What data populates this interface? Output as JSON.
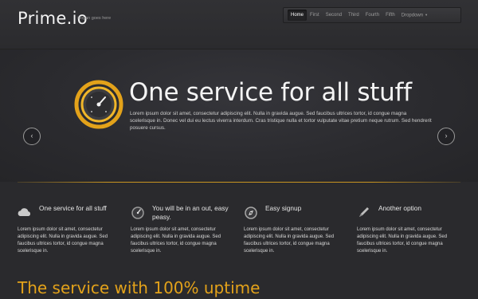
{
  "header": {
    "logo": "Prime.io",
    "slogan": "slogan goes here",
    "nav": [
      "Home",
      "First",
      "Second",
      "Third",
      "Fourth",
      "Fifth",
      "Dropdown"
    ]
  },
  "hero": {
    "title": "One service for all stuff",
    "text": "Lorem ipsum dolor sit amet, consectetur adipiscing elit. Nulla in gravida augue. Sed faucibus ultrices tortor, id congue magna scelerisque in. Donec vel dui eu lectus viverra interdum. Cras tristique nulla et tortor vulputate vitae pretium neque rutrum. Sed hendrerit posuere cursus.",
    "prev_icon": "chevron-left-icon",
    "next_icon": "chevron-right-icon",
    "accent": "#e3a21a"
  },
  "features": [
    {
      "title": "One service for all stuff",
      "icon": "cloud-icon",
      "text": "Lorem ipsum dolor sit amet, consectetur adipiscing elit. Nulla in gravida augue. Sed faucibus ultrices tortor, id congue magna scelerisque in."
    },
    {
      "title": "You will be in an out, easy peasy.",
      "icon": "gauge-icon",
      "text": "Lorem ipsum dolor sit amet, consectetur adipiscing elit. Nulla in gravida augue. Sed faucibus ultrices tortor, id congue magna scelerisque in."
    },
    {
      "title": "Easy signup",
      "icon": "compass-icon",
      "text": "Lorem ipsum dolor sit amet, consectetur adipiscing elit. Nulla in gravida augue. Sed faucibus ultrices tortor, id congue magna scelerisque in."
    },
    {
      "title": "Another option",
      "icon": "pen-icon",
      "text": "Lorem ipsum dolor sit amet, consectetur adipiscing elit. Nulla in gravida augue. Sed faucibus ultrices tortor, id congue magna scelerisque in."
    }
  ],
  "bottom": {
    "title": "The service with 100% uptime"
  }
}
